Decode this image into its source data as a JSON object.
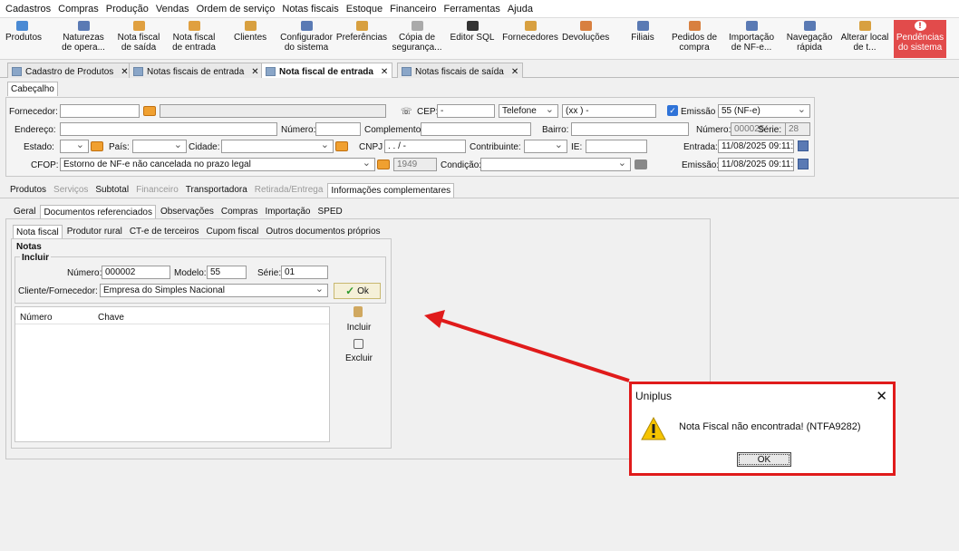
{
  "menu": [
    "Cadastros",
    "Compras",
    "Produção",
    "Vendas",
    "Ordem de serviço",
    "Notas fiscais",
    "Estoque",
    "Financeiro",
    "Ferramentas",
    "Ajuda"
  ],
  "toolbar": [
    {
      "label": "Produtos",
      "icon": "products-icon",
      "color": "#4a8ad4"
    },
    {
      "label": "Naturezas de opera...",
      "icon": "nature-icon",
      "color": "#5a7ab4"
    },
    {
      "label": "Nota fiscal de saída",
      "icon": "invoice-out-icon",
      "color": "#e0a040"
    },
    {
      "label": "Nota fiscal de entrada",
      "icon": "invoice-in-icon",
      "color": "#e0a040"
    },
    {
      "label": "Clientes",
      "icon": "clients-icon",
      "color": "#d8a040"
    },
    {
      "label": "Configurador do sistema",
      "icon": "config-icon",
      "color": "#5a7ab4"
    },
    {
      "label": "Preferências",
      "icon": "preferences-icon",
      "color": "#d8a040"
    },
    {
      "label": "Cópia de segurança...",
      "icon": "backup-icon",
      "color": "#aaaaaa"
    },
    {
      "label": "Editor SQL",
      "icon": "sql-icon",
      "color": "#333333"
    },
    {
      "label": "Fornecedores",
      "icon": "suppliers-icon",
      "color": "#d8a040"
    },
    {
      "label": "Devoluções",
      "icon": "returns-icon",
      "color": "#d88040"
    },
    {
      "label": "Filiais",
      "icon": "branches-icon",
      "color": "#5a7ab4"
    },
    {
      "label": "Pedidos de compra",
      "icon": "purchase-orders-icon",
      "color": "#d88040"
    },
    {
      "label": "Importação de NF-e...",
      "icon": "import-icon",
      "color": "#5a7ab4"
    },
    {
      "label": "Navegação rápida",
      "icon": "quick-nav-icon",
      "color": "#5a7ab4"
    },
    {
      "label": "Alterar local de t...",
      "icon": "home-icon",
      "color": "#d8a040"
    },
    {
      "label": "Pendências do sistema",
      "icon": "alert-icon",
      "color": "#e24b4b"
    }
  ],
  "doc_tabs": [
    "Cadastro de Produtos",
    "Notas fiscais de entrada",
    "Nota fiscal de entrada",
    "Notas fiscais de saída"
  ],
  "header_tab": "Cabeçalho",
  "form": {
    "fornecedor_label": "Fornecedor:",
    "cep_label": "CEP:",
    "cep_value": "-",
    "telefone_label": "Telefone",
    "telefone_value": "(xx )   -",
    "emissao_label": "Emissão",
    "emissao_value": "55 (NF-e)",
    "endereco_label": "Endereço:",
    "numero_label": "Número:",
    "complemento_label": "Complemento:",
    "bairro_label": "Bairro:",
    "numero_nf_label": "Número:",
    "numero_nf_value": "000025",
    "serie_label": "Série:",
    "serie_value": "28",
    "estado_label": "Estado:",
    "pais_label": "País:",
    "cidade_label": "Cidade:",
    "cnpj_label": "CNPJ",
    "cnpj_value": ". . /  -",
    "contribuinte_label": "Contribuinte:",
    "ie_label": "IE:",
    "entrada_label": "Entrada:",
    "entrada_value": "11/08/2025 09:11:28",
    "cfop_label": "CFOP:",
    "cfop_value": "Estorno de NF-e não cancelada no prazo legal",
    "cfop_code": "1949",
    "condicao_label": "Condição:",
    "emissao2_label": "Emissão:",
    "emissao2_value": "11/08/2025 09:11:28"
  },
  "main_tabs": [
    {
      "label": "Produtos",
      "state": "normal"
    },
    {
      "label": "Serviços",
      "state": "disabled"
    },
    {
      "label": "Subtotal",
      "state": "normal"
    },
    {
      "label": "Financeiro",
      "state": "disabled"
    },
    {
      "label": "Transportadora",
      "state": "normal"
    },
    {
      "label": "Retirada/Entrega",
      "state": "disabled"
    },
    {
      "label": "Informações complementares",
      "state": "selected"
    }
  ],
  "sub_tabs": [
    {
      "label": "Geral",
      "state": "normal"
    },
    {
      "label": "Documentos referenciados",
      "state": "selected"
    },
    {
      "label": "Observações",
      "state": "normal"
    },
    {
      "label": "Compras",
      "state": "normal"
    },
    {
      "label": "Importação",
      "state": "normal"
    },
    {
      "label": "SPED",
      "state": "normal"
    }
  ],
  "doc_tabs2": [
    {
      "label": "Nota fiscal",
      "state": "selected"
    },
    {
      "label": "Produtor rural",
      "state": "normal"
    },
    {
      "label": "CT-e de terceiros",
      "state": "normal"
    },
    {
      "label": "Cupom fiscal",
      "state": "normal"
    },
    {
      "label": "Outros documentos próprios",
      "state": "normal"
    }
  ],
  "notas": {
    "title": "Notas",
    "incluir_group": "Incluir",
    "numero_label": "Número:",
    "numero_value": "000002",
    "modelo_label": "Modelo:",
    "modelo_value": "55",
    "serie_label": "Série:",
    "serie_value": "01",
    "cliente_label": "Cliente/Fornecedor:",
    "cliente_value": "Empresa do Simples Nacional",
    "ok_label": "Ok",
    "col_numero": "Número",
    "col_chave": "Chave",
    "incluir_btn": "Incluir",
    "excluir_btn": "Excluir"
  },
  "dialog": {
    "title": "Uniplus",
    "message": "Nota Fiscal não encontrada! (NTFA9282)",
    "ok": "OK",
    "close": "✕"
  },
  "colors": {
    "annotation": "#e01b1b",
    "accent": "#2f73d8"
  }
}
